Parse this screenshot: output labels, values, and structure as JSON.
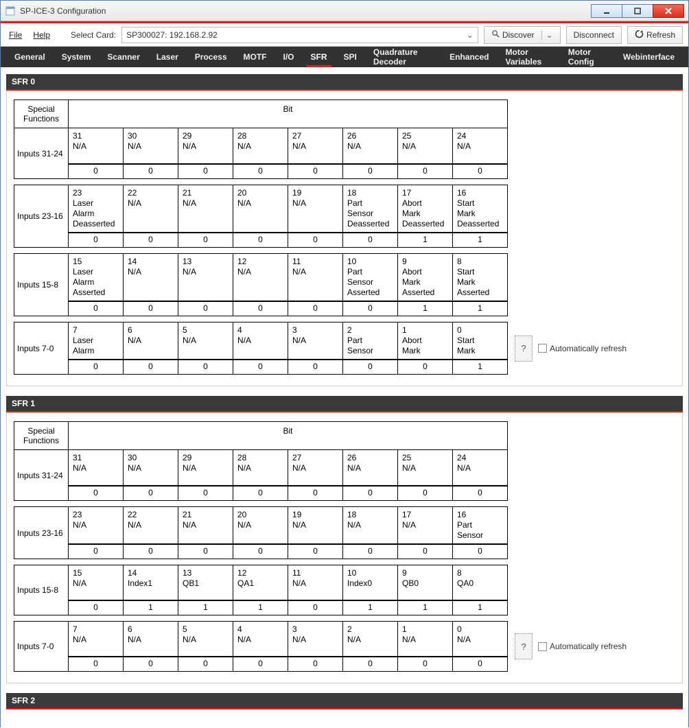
{
  "window": {
    "title": "SP-ICE-3 Configuration"
  },
  "menu": {
    "file": "File",
    "help": "Help"
  },
  "toolbar": {
    "select_card_label": "Select Card:",
    "selected_card": "SP300027: 192.168.2.92",
    "discover": "Discover",
    "disconnect": "Disconnect",
    "refresh": "Refresh"
  },
  "tabs": [
    "General",
    "System",
    "Scanner",
    "Laser",
    "Process",
    "MOTF",
    "I/O",
    "SFR",
    "SPI",
    "Quadrature Decoder",
    "Enhanced",
    "Motor Variables",
    "Motor Config",
    "Webinterface"
  ],
  "active_tab": "SFR",
  "common": {
    "special_functions": "Special\nFunctions",
    "bit": "Bit",
    "question": "?",
    "auto_refresh": "Automatically refresh"
  },
  "sections": [
    {
      "title": "SFR 0",
      "groups": [
        {
          "label": "Inputs 31-24",
          "bits": [
            {
              "n": "31",
              "name": "N/A",
              "v": "0"
            },
            {
              "n": "30",
              "name": "N/A",
              "v": "0"
            },
            {
              "n": "29",
              "name": "N/A",
              "v": "0"
            },
            {
              "n": "28",
              "name": "N/A",
              "v": "0"
            },
            {
              "n": "27",
              "name": "N/A",
              "v": "0"
            },
            {
              "n": "26",
              "name": "N/A",
              "v": "0"
            },
            {
              "n": "25",
              "name": "N/A",
              "v": "0"
            },
            {
              "n": "24",
              "name": "N/A",
              "v": "0"
            }
          ]
        },
        {
          "label": "Inputs 23-16",
          "bits": [
            {
              "n": "23",
              "name": "Laser\nAlarm\nDeasserted",
              "v": "0"
            },
            {
              "n": "22",
              "name": "N/A",
              "v": "0"
            },
            {
              "n": "21",
              "name": "N/A",
              "v": "0"
            },
            {
              "n": "20",
              "name": "N/A",
              "v": "0"
            },
            {
              "n": "19",
              "name": "N/A",
              "v": "0"
            },
            {
              "n": "18",
              "name": "Part\nSensor\nDeasserted",
              "v": "0"
            },
            {
              "n": "17",
              "name": "Abort\nMark\nDeasserted",
              "v": "1"
            },
            {
              "n": "16",
              "name": "Start\nMark\nDeasserted",
              "v": "1"
            }
          ]
        },
        {
          "label": "Inputs 15-8",
          "bits": [
            {
              "n": "15",
              "name": "Laser\nAlarm\nAsserted",
              "v": "0"
            },
            {
              "n": "14",
              "name": "N/A",
              "v": "0"
            },
            {
              "n": "13",
              "name": "N/A",
              "v": "0"
            },
            {
              "n": "12",
              "name": "N/A",
              "v": "0"
            },
            {
              "n": "11",
              "name": "N/A",
              "v": "0"
            },
            {
              "n": "10",
              "name": "Part\nSensor\nAsserted",
              "v": "0"
            },
            {
              "n": "9",
              "name": "Abort\nMark\nAsserted",
              "v": "1"
            },
            {
              "n": "8",
              "name": "Start\nMark\nAsserted",
              "v": "1"
            }
          ]
        },
        {
          "label": "Inputs 7-0",
          "bits": [
            {
              "n": "7",
              "name": "Laser\nAlarm",
              "v": "0"
            },
            {
              "n": "6",
              "name": "N/A",
              "v": "0"
            },
            {
              "n": "5",
              "name": "N/A",
              "v": "0"
            },
            {
              "n": "4",
              "name": "N/A",
              "v": "0"
            },
            {
              "n": "3",
              "name": "N/A",
              "v": "0"
            },
            {
              "n": "2",
              "name": "Part\nSensor",
              "v": "0"
            },
            {
              "n": "1",
              "name": "Abort\nMark",
              "v": "0"
            },
            {
              "n": "0",
              "name": "Start\nMark",
              "v": "1"
            }
          ],
          "side": true
        }
      ]
    },
    {
      "title": "SFR 1",
      "groups": [
        {
          "label": "Inputs 31-24",
          "bits": [
            {
              "n": "31",
              "name": "N/A",
              "v": "0"
            },
            {
              "n": "30",
              "name": "N/A",
              "v": "0"
            },
            {
              "n": "29",
              "name": "N/A",
              "v": "0"
            },
            {
              "n": "28",
              "name": "N/A",
              "v": "0"
            },
            {
              "n": "27",
              "name": "N/A",
              "v": "0"
            },
            {
              "n": "26",
              "name": "N/A",
              "v": "0"
            },
            {
              "n": "25",
              "name": "N/A",
              "v": "0"
            },
            {
              "n": "24",
              "name": "N/A",
              "v": "0"
            }
          ]
        },
        {
          "label": "Inputs 23-16",
          "bits": [
            {
              "n": "23",
              "name": "N/A",
              "v": "0"
            },
            {
              "n": "22",
              "name": "N/A",
              "v": "0"
            },
            {
              "n": "21",
              "name": "N/A",
              "v": "0"
            },
            {
              "n": "20",
              "name": "N/A",
              "v": "0"
            },
            {
              "n": "19",
              "name": "N/A",
              "v": "0"
            },
            {
              "n": "18",
              "name": "N/A",
              "v": "0"
            },
            {
              "n": "17",
              "name": "N/A",
              "v": "0"
            },
            {
              "n": "16",
              "name": "Part\nSensor",
              "v": "0"
            }
          ]
        },
        {
          "label": "Inputs 15-8",
          "bits": [
            {
              "n": "15",
              "name": "N/A",
              "v": "0"
            },
            {
              "n": "14",
              "name": "Index1",
              "v": "1"
            },
            {
              "n": "13",
              "name": "QB1",
              "v": "1"
            },
            {
              "n": "12",
              "name": "QA1",
              "v": "1"
            },
            {
              "n": "11",
              "name": "N/A",
              "v": "0"
            },
            {
              "n": "10",
              "name": "Index0",
              "v": "1"
            },
            {
              "n": "9",
              "name": "QB0",
              "v": "1"
            },
            {
              "n": "8",
              "name": "QA0",
              "v": "1"
            }
          ]
        },
        {
          "label": "Inputs 7-0",
          "bits": [
            {
              "n": "7",
              "name": "N/A",
              "v": "0"
            },
            {
              "n": "6",
              "name": "N/A",
              "v": "0"
            },
            {
              "n": "5",
              "name": "N/A",
              "v": "0"
            },
            {
              "n": "4",
              "name": "N/A",
              "v": "0"
            },
            {
              "n": "3",
              "name": "N/A",
              "v": "0"
            },
            {
              "n": "2",
              "name": "N/A",
              "v": "0"
            },
            {
              "n": "1",
              "name": "N/A",
              "v": "0"
            },
            {
              "n": "0",
              "name": "N/A",
              "v": "0"
            }
          ],
          "side": true
        }
      ]
    },
    {
      "title": "SFR 2",
      "groups": []
    }
  ]
}
